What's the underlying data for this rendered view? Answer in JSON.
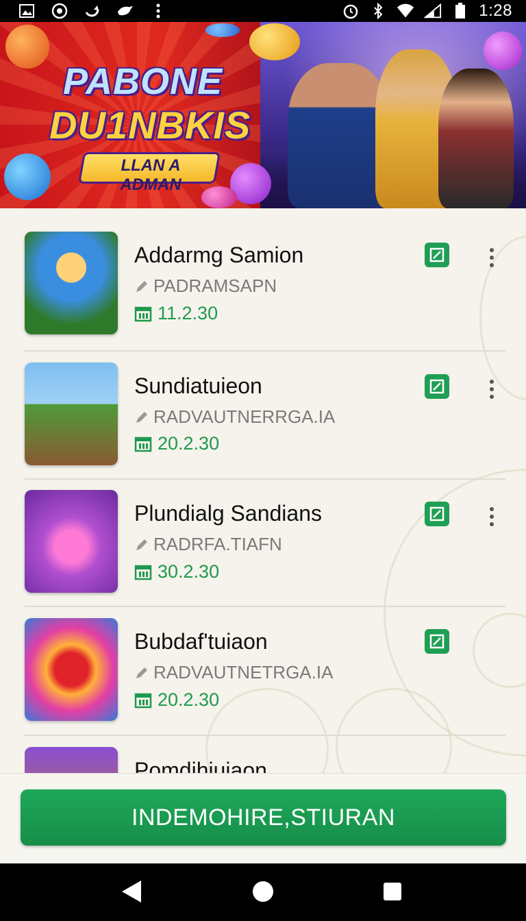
{
  "status_bar": {
    "time": "1:28",
    "left_icons": [
      "image-icon",
      "app-icon",
      "sync-icon",
      "bird-icon",
      "overflow-dots-icon"
    ],
    "right_icons": [
      "alarm-icon",
      "bluetooth-icon",
      "wifi-icon",
      "signal-icon",
      "battery-icon"
    ]
  },
  "banner": {
    "title_line1": "PABONE",
    "title_line2": "DU1NBKIS",
    "subtitle": "LLAN A ADMAN"
  },
  "items": [
    {
      "title": "Addarmg Samion",
      "subtitle": "PADRAMSAPN",
      "version": "11.2.30",
      "thumb_icon": "clown-character-icon"
    },
    {
      "title": "Sundiatuieon",
      "subtitle": "RADVAUTNERRGA.IA",
      "version": "20.2.30",
      "thumb_icon": "fox-character-icon"
    },
    {
      "title": "Plundialg Sandians",
      "subtitle": "RADRFA.TIAFN",
      "version": "30.2.30",
      "thumb_icon": "magician-character-icon"
    },
    {
      "title": "Bubdaf'tuiaon",
      "subtitle": "RADVAUTNETRGA.IA",
      "version": "20.2.30",
      "thumb_icon": "red-dice-icon"
    },
    {
      "title": "Pomdihiuiaon",
      "subtitle": "",
      "version": "",
      "thumb_icon": "character-icon"
    }
  ],
  "primary_button": {
    "label": "INDEMOHIRE,STIURAN"
  },
  "colors": {
    "accent_green": "#1f9e55",
    "version_green": "#1e9a4e"
  }
}
